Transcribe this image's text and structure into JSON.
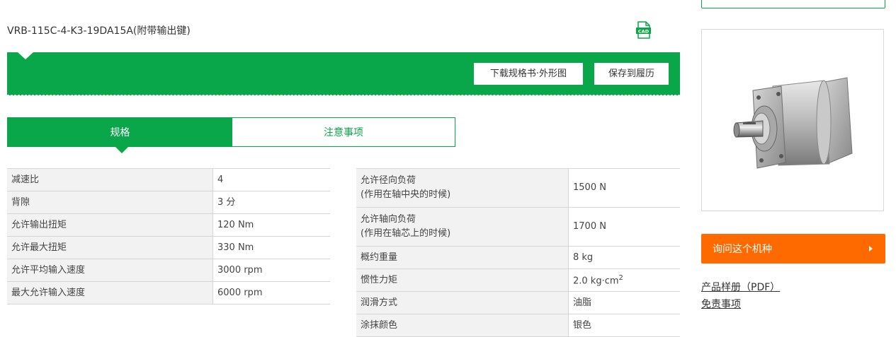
{
  "product": {
    "title": "VRB-115C-4-K3-19DA15A(附带输出键)",
    "cad_badge": "CAD"
  },
  "toolbar": {
    "download_label": "下载规格书·外形图",
    "save_label": "保存到履历"
  },
  "tabs": [
    {
      "label": "规格",
      "active": true
    },
    {
      "label": "注意事项",
      "active": false
    }
  ],
  "specs_left": [
    {
      "label": "减速比",
      "value": "4"
    },
    {
      "label": "背隙",
      "value": "3 分"
    },
    {
      "label": "允许输出扭矩",
      "value": "120 Nm"
    },
    {
      "label": "允许最大扭矩",
      "value": "330 Nm"
    },
    {
      "label": "允许平均输入速度",
      "value": "3000 rpm"
    },
    {
      "label": "最大允许输入速度",
      "value": "6000 rpm"
    }
  ],
  "specs_right": [
    {
      "label": "允许径向负荷",
      "sublabel": "(作用在轴中央的时候)",
      "value": "1500 N"
    },
    {
      "label": "允许轴向负荷",
      "sublabel": "(作用在轴芯上的时候)",
      "value": "1700 N"
    },
    {
      "label": "概约重量",
      "value": "8 kg"
    },
    {
      "label": "惯性力矩",
      "value": "2.0 kg·cm",
      "value_sup": "2"
    },
    {
      "label": "润滑方式",
      "value": "油脂"
    },
    {
      "label": "涂抹颜色",
      "value": "银色"
    }
  ],
  "sidebar": {
    "inquiry_label": "询问这个机种",
    "catalog_link": "产品样册（PDF）",
    "disclaimer_link": "免责事项"
  },
  "colors": {
    "brand_green": "#0aa64a",
    "inquiry_orange": "#ff6a00"
  }
}
